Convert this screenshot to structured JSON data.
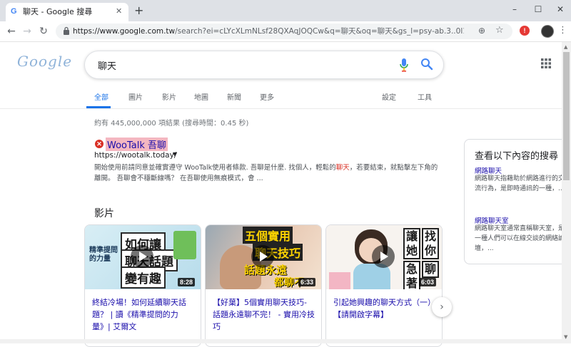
{
  "browser": {
    "tab_title": "聊天 - Google 搜尋",
    "favicon": "G",
    "new_tab": "+",
    "url_host": "https://www.google.com.tw",
    "url_path": "/search?ei=cLYcXLmNLsf28QXAqJOQCw&q=聊天&oq=聊天&gs_l=psy-ab.3..0l10.4829.1...",
    "ext_label": "!",
    "window": {
      "minimize": "–",
      "maximize": "☐",
      "close": "✕"
    }
  },
  "google": {
    "logo_text": "Google",
    "query": "聊天",
    "tabs": [
      {
        "label": "全部"
      },
      {
        "label": "圖片"
      },
      {
        "label": "影片"
      },
      {
        "label": "地圖"
      },
      {
        "label": "新聞"
      },
      {
        "label": "更多"
      },
      {
        "label": "設定"
      },
      {
        "label": "工具"
      }
    ],
    "stats": "約有 445,000,000 項結果 (搜尋時間：0.45 秒)"
  },
  "result1": {
    "icon": "✕",
    "title": "WooTalk 吾聊",
    "url": "https://wootalk.today/",
    "snippet_part1": "開始使用前請同意並確實遵守 WooTalk使用者條款. 吾聊是什麼. 找個人，輕鬆的",
    "snippet_highlight": "聊天",
    "snippet_part2": "，若要結束，就點擊左下角的離開。 吾聊會不穩斷線嗎？ 在吾聊使用無痕模式，會 ..."
  },
  "videos": {
    "heading": "影片",
    "items": [
      {
        "title": "終結冷場！如何延續聊天話題？ | 讀《精準提問的力量》| 艾爾文",
        "duration": "8:28",
        "thumb_text_1": "如何讓",
        "thumb_text_2": "聊天話題",
        "thumb_text_3": "變有趣",
        "thumb_text_4": "精準提問的力量"
      },
      {
        "title": "【好葉】5個實用聊天技巧- 話題永遠聊不完！ - 實用冷技巧",
        "duration": "6:33",
        "thumb_text_1": "五個實用",
        "thumb_text_2": "聊天技巧",
        "thumb_text_3": "話題永遠",
        "thumb_text_4": "都聊不"
      },
      {
        "title": "引起她興趣的聊天方式（一）【請開啟字幕】",
        "duration": "6:03",
        "thumb_text_1": "讓她",
        "thumb_text_2": "急著",
        "thumb_text_3": "找你",
        "thumb_text_4": "聊"
      }
    ]
  },
  "side_panel": {
    "title": "查看以下內容的搜尋",
    "items": [
      {
        "link": "網路聊天",
        "desc": "網路聊天指藉助於網路進行的交流行為，是即時通訊的一種，..."
      },
      {
        "link": "網路聊天室",
        "desc": "網路聊天室通常直稱聊天室，是一種人們可以在線交談的網絡論壇，..."
      }
    ]
  },
  "colors": {
    "link": "#1a0dab",
    "accent": "#1a73e8",
    "highlight": "#d93025"
  }
}
